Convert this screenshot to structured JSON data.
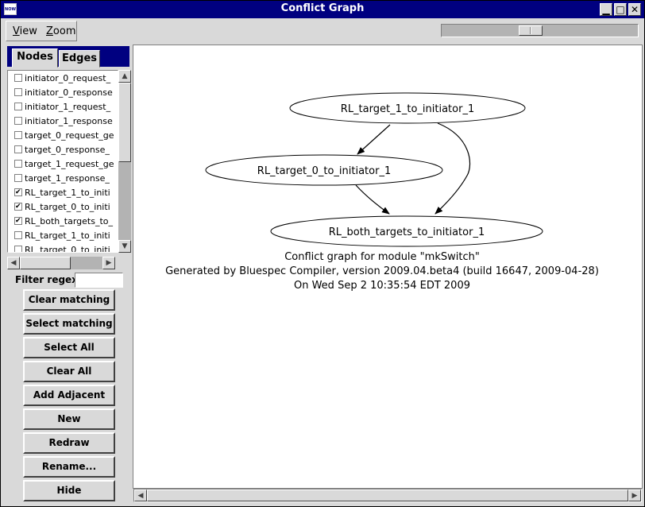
{
  "window": {
    "title": "Conflict Graph",
    "icon_label": "NOW"
  },
  "menubar": {
    "view_first": "V",
    "view_rest": "iew",
    "zoom_first": "Z",
    "zoom_rest": "oom"
  },
  "zoom_slider": {
    "value_fraction": 0.48
  },
  "tabs": [
    {
      "label": "Nodes",
      "active": true
    },
    {
      "label": "Edges",
      "active": false
    }
  ],
  "node_list": [
    {
      "label": "initiator_0_request_",
      "checked": false
    },
    {
      "label": "initiator_0_response",
      "checked": false
    },
    {
      "label": "initiator_1_request_",
      "checked": false
    },
    {
      "label": "initiator_1_response",
      "checked": false
    },
    {
      "label": "target_0_request_ge",
      "checked": false
    },
    {
      "label": "target_0_response_",
      "checked": false
    },
    {
      "label": "target_1_request_ge",
      "checked": false
    },
    {
      "label": "target_1_response_",
      "checked": false
    },
    {
      "label": "RL_target_1_to_initi",
      "checked": true
    },
    {
      "label": "RL_target_0_to_initi",
      "checked": true
    },
    {
      "label": "RL_both_targets_to_",
      "checked": true
    },
    {
      "label": "RL_target_1_to_initi",
      "checked": false
    },
    {
      "label": "RL_target_0_to_initi",
      "checked": false
    }
  ],
  "filter": {
    "label": "Filter regex",
    "value": ""
  },
  "buttons": {
    "clear_matching": "Clear matching",
    "select_matching": "Select matching",
    "select_all": "Select All",
    "clear_all": "Clear All",
    "add_adjacent": "Add Adjacent",
    "new": "New",
    "redraw": "Redraw",
    "rename": "Rename...",
    "hide": "Hide"
  },
  "graph": {
    "nodes": {
      "n1": "RL_target_1_to_initiator_1",
      "n2": "RL_target_0_to_initiator_1",
      "n3": "RL_both_targets_to_initiator_1"
    },
    "edges": [
      {
        "from": "n1",
        "to": "n2"
      },
      {
        "from": "n1",
        "to": "n3"
      },
      {
        "from": "n2",
        "to": "n3"
      }
    ],
    "caption_line1": "Conflict graph for module \"mkSwitch\"",
    "caption_line2": "Generated by Bluespec Compiler, version 2009.04.beta4 (build 16647, 2009-04-28)",
    "caption_line3": "On Wed Sep  2 10:35:54 EDT 2009"
  }
}
